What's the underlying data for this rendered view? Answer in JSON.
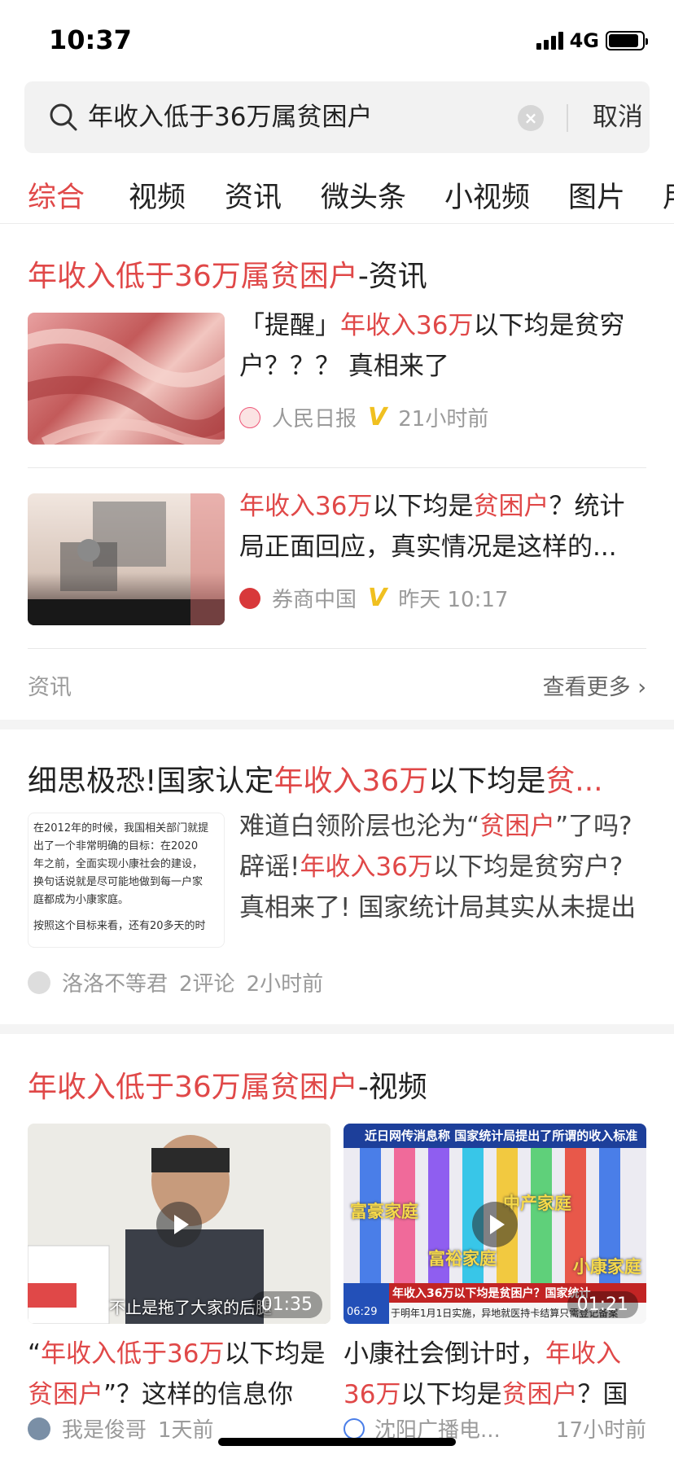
{
  "status_bar": {
    "time": "10:37",
    "network": "4G",
    "battery_level": 0.9
  },
  "search": {
    "query": "年收入低于36万属贫困户",
    "cancel_label": "取消"
  },
  "tabs": [
    "综合",
    "视频",
    "资讯",
    "微头条",
    "小视频",
    "图片",
    "用"
  ],
  "active_tab": 0,
  "news_section": {
    "title_highlight": "年收入低于36万属贫困户",
    "title_suffix": "-资讯",
    "items": [
      {
        "title_parts": [
          {
            "text": "「提醒」",
            "hl": false
          },
          {
            "text": "年收入36万",
            "hl": true
          },
          {
            "text": "以下均是贫穷户？？？ 真相来了",
            "hl": false
          }
        ],
        "source": "人民日报",
        "time": "21小时前",
        "thumb_icon": "rmb-banknotes-image"
      },
      {
        "title_parts": [
          {
            "text": "年收入36万",
            "hl": true
          },
          {
            "text": "以下均是",
            "hl": false
          },
          {
            "text": "贫困户",
            "hl": true
          },
          {
            "text": "？统计局正面回应，真实情况是这样的...",
            "hl": false
          }
        ],
        "source": "券商中国",
        "time": "昨天 10:17",
        "thumb_icon": "poverty-illustration-image"
      }
    ],
    "footer_label": "资讯",
    "more_label": "查看更多"
  },
  "article": {
    "title_parts": [
      {
        "text": "细思极恐!国家认定",
        "hl": false
      },
      {
        "text": "年收入36万",
        "hl": true
      },
      {
        "text": "以下均是",
        "hl": false
      },
      {
        "text": "贫...",
        "hl": true
      }
    ],
    "thumb_lines": [
      "在2012年的时候，我国相关部门就提",
      "出了一个非常明确的目标：在2020",
      "年之前，全面实现小康社会的建设，",
      "换句话说就是尽可能地做到每一户家",
      "庭都成为小康家庭。",
      "按照这个目标来看，还有20多天的时"
    ],
    "summary_parts": [
      {
        "text": "难道白领阶层也沦为“",
        "hl": false
      },
      {
        "text": "贫困户",
        "hl": true
      },
      {
        "text": "”了吗? 辟谣!",
        "hl": false
      },
      {
        "text": "年收入36万",
        "hl": true
      },
      {
        "text": "以下均是贫穷户?真相来了! 国家统计局其实从未提出过上述家...",
        "hl": false
      }
    ],
    "author": "洛洛不等君",
    "comments": "2评论",
    "time": "2小时前"
  },
  "video_section": {
    "title_highlight": "年收入低于36万属贫困户",
    "title_suffix": "-视频",
    "videos": [
      {
        "duration": "01:35",
        "subtitle": "不止是拖了大家的后腿",
        "title_parts": [
          {
            "text": "“",
            "hl": false
          },
          {
            "text": "年收入低于36万",
            "hl": true
          },
          {
            "text": "以下均是",
            "hl": false
          },
          {
            "text": "贫困户",
            "hl": true
          },
          {
            "text": "”？这样的信息你怎...",
            "hl": false
          }
        ],
        "author": "我是俊哥",
        "time": "1天前"
      },
      {
        "duration": "01:21",
        "banner": "近日网传消息称 国家统计局提出了所谓的收入标准",
        "labels": [
          "富豪家庭",
          "中产家庭",
          "富裕家庭",
          "小康家庭"
        ],
        "ticker": "年收入36万以下均是贫困户？国家统计",
        "ticker2": "于明年1月1日实施，异地就医持卡结算只需登记备案",
        "clock": "06:29",
        "title_parts": [
          {
            "text": "小康社会倒计时，",
            "hl": false
          },
          {
            "text": "年收入36万",
            "hl": true
          },
          {
            "text": "以下均是",
            "hl": false
          },
          {
            "text": "贫困户",
            "hl": true
          },
          {
            "text": "？国家...",
            "hl": false
          }
        ],
        "author": "沈阳广播电...",
        "time": "17小时前"
      }
    ]
  },
  "colors": {
    "accent": "#e04848",
    "verified": "#f0c020",
    "muted": "#9a9a9a"
  }
}
